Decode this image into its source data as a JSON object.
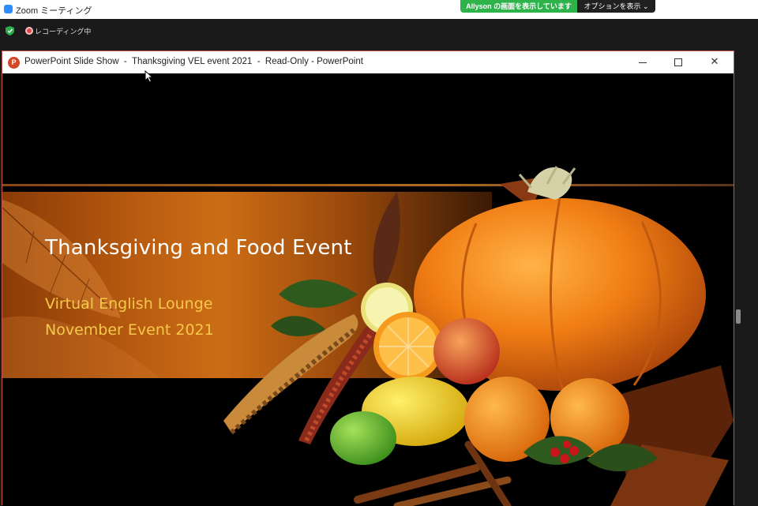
{
  "zoom": {
    "window_title": "Zoom ミーティング",
    "share_banner": "Allyson の画面を表示しています",
    "options_button": "オプションを表示 ⌄",
    "recording_label": "レコーディング中"
  },
  "powerpoint": {
    "logo_letter": "P",
    "window_title": "PowerPoint Slide Show  -  Thanksgiving VEL event 2021  -  Read-Only - PowerPoint",
    "close_symbol": "✕"
  },
  "slide": {
    "title": "Thanksgiving and Food Event",
    "subtitle_line1": "Virtual English Lounge",
    "subtitle_line2": "November Event 2021"
  },
  "colors": {
    "zoom_green": "#2eb34a",
    "powerpoint_red": "#d24726",
    "title_white": "#ffffff",
    "subtitle_gold": "#f6c94a"
  },
  "icons": [
    "zoom-icon",
    "shield-icon",
    "recording-icon",
    "powerpoint-icon",
    "minimize-icon",
    "maximize-icon",
    "close-icon",
    "cursor-icon"
  ]
}
